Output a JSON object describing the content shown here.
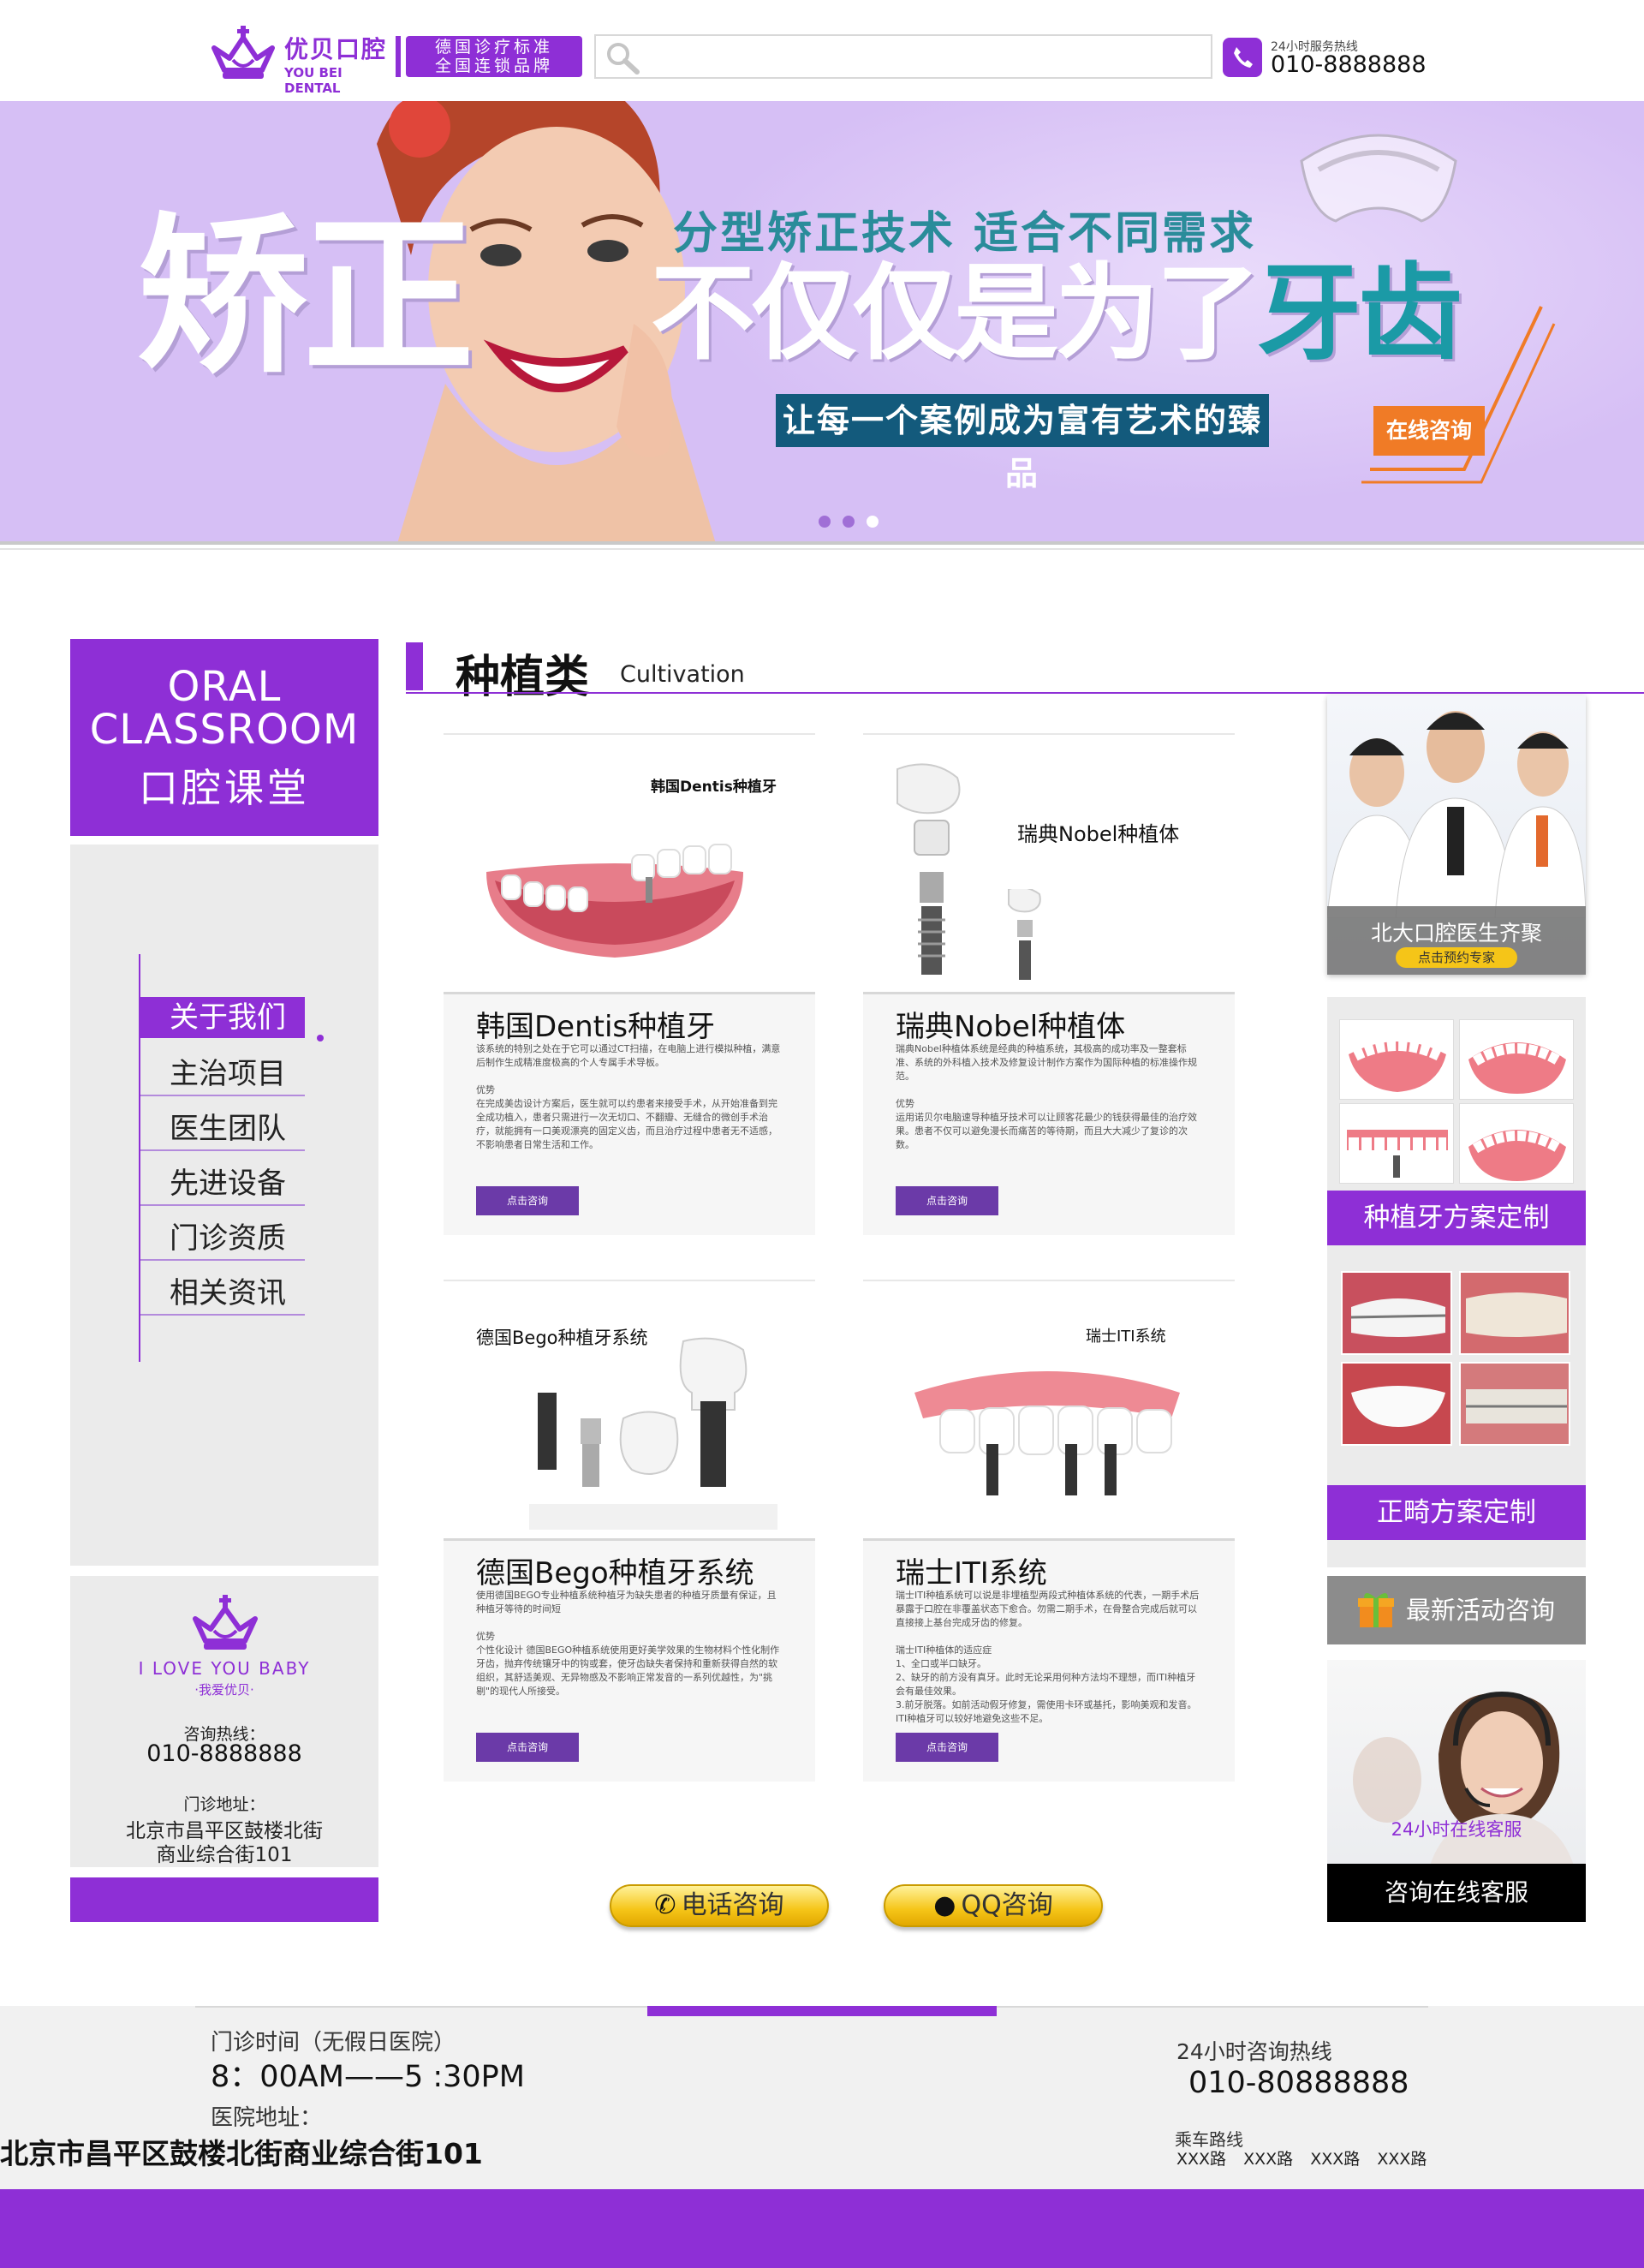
{
  "header": {
    "logo_name": "优贝口腔",
    "logo_en": "YOU BEI DENTAL",
    "slogan_line1": "德国诊疗标准",
    "slogan_line2": "全国连锁品牌",
    "search_placeholder": "",
    "hotline_label": "24小时服务热线",
    "hotline_number": "010-8888888"
  },
  "banner": {
    "big_text": "矫正",
    "subtitle": "分型矫正技术  适合不同需求",
    "headline_part1": "不仅仅是为了",
    "headline_part2": "牙齿",
    "tagline": "让每一个案例成为富有艺术的臻品",
    "cta": "在线咨询",
    "slides": 3,
    "active_slide": 3
  },
  "sidebar": {
    "classroom_en1": "ORAL",
    "classroom_en2": "CLASSROOM",
    "classroom_cn": "口腔课堂",
    "nav": [
      {
        "label": "关于我们",
        "active": true
      },
      {
        "label": "主治项目",
        "active": false
      },
      {
        "label": "医生团队",
        "active": false
      },
      {
        "label": "先进设备",
        "active": false
      },
      {
        "label": "门诊资质",
        "active": false
      },
      {
        "label": "相关资讯",
        "active": false
      }
    ],
    "contact": {
      "love": "I LOVE YOU BABY",
      "love_cn": "·我爱优贝·",
      "hotline_label": "咨询热线：",
      "hotline": "010-8888888",
      "address_label": "门诊地址：",
      "address_line1": "北京市昌平区鼓楼北街",
      "address_line2": "商业综合街101"
    }
  },
  "main": {
    "section_title": "种植类",
    "section_en": "Cultivation",
    "cards": [
      {
        "image_label": "韩国Dentis种植牙",
        "name": "韩国Dentis种植牙",
        "desc": "该系统的特别之处在于它可以通过CT扫描，在电脑上进行模拟种植，满意后制作生成精准度极高的个人专属手术导板。\n\n优势\n在完成美齿设计方案后，医生就可以约患者来接受手术，从开始准备到完全成功植入，患者只需进行一次无切口、不翻瓣、无缝合的微创手术治疗，就能拥有一口美观漂亮的固定义齿，而且治疗过程中患者无不适感，不影响患者日常生活和工作。",
        "button": "点击咨询"
      },
      {
        "image_label": "瑞典Nobel种植体",
        "name": "瑞典Nobel种植体",
        "desc": "瑞典Nobel种植体系统是经典的种植系统，其极高的成功率及一整套标准、系统的外科植入技术及修复设计制作方案作为国际种植的标准操作规范。\n\n优势\n运用诺贝尔电脑速导种植牙技术可以让顾客花最少的钱获得最佳的治疗效果。患者不仅可以避免漫长而痛苦的等待期，而且大大减少了复诊的次数。",
        "button": "点击咨询"
      },
      {
        "image_label": "德国Bego种植牙系统",
        "name": "德国Bego种植牙系统",
        "desc": "使用德国BEGO专业种植系统种植牙为缺失患者的种植牙质量有保证，且种植牙等待的时间短\n\n优势\n个性化设计 德国BEGO种植系统使用更好美学效果的生物材料个性化制作牙齿，抛弃传统镶牙中的钩或套，使牙齿缺失者保持和重新获得自然的软组织，其舒适美观、无异物感及不影响正常发音的一系列优越性，为\"挑剔\"的现代人所接受。",
        "button": "点击咨询"
      },
      {
        "image_label": "瑞士ITI系统",
        "name": "瑞士ITI系统",
        "desc": "瑞士ITI种植系统可以说是非埋植型两段式种植体系统的代表，一期手术后暴露于口腔在非覆盖状态下愈合。勿需二期手术，在骨整合完成后就可以直接接上基台完成牙齿的修复。\n\n瑞士ITI种植体的适应症\n1、全口或半口缺牙。\n2、缺牙的前方没有真牙。此时无论采用何种方法均不理想，而ITI种植牙会有最佳效果。\n3.前牙脱落。如前活动假牙修复，需使用卡环或基托，影响美观和发音。ITI种植牙可以较好地避免这些不足。",
        "button": "点击咨询"
      }
    ],
    "phone_button": "电话咨询",
    "qq_button": "QQ咨询"
  },
  "right": {
    "doctors_title": "北大口腔医生齐聚",
    "doctors_button": "点击预约专家",
    "implant_plan": "种植牙方案定制",
    "ortho_plan": "正畸方案定制",
    "activity": "最新活动咨询",
    "service_24h": "24小时在线客服",
    "service_cta": "咨询在线客服"
  },
  "footer": {
    "hours_label": "门诊时间（无假日医院）",
    "hours": "8：00AM——5 :30PM",
    "address_label": "医院地址：",
    "address": "北京市昌平区鼓楼北街商业综合街101",
    "hotline_label": "24小时咨询热线",
    "hotline": "010-80888888",
    "route_label": "乘车路线",
    "routes": [
      "XXX路",
      "XXX路",
      "XXX路",
      "XXX路"
    ]
  },
  "colors": {
    "brand_purple": "#8e2fd6",
    "banner_bg": "#d6bff5",
    "teal": "#1b9aa6",
    "cta_orange": "#f07b26",
    "gold": "#f5c518"
  }
}
